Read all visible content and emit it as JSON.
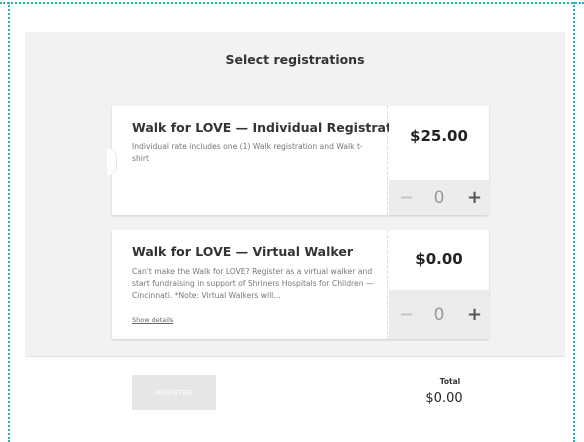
{
  "page": {
    "title": "Select registrations"
  },
  "registrations": [
    {
      "name": "Walk for LOVE — Individual Registration",
      "description": "Individual rate includes one (1) Walk registration and Walk t-shirt",
      "price": "$25.00",
      "quantity": "0",
      "minus": "−",
      "plus": "+"
    },
    {
      "name": "Walk for LOVE — Virtual Walker",
      "description": "Can't make the Walk for LOVE? Register as a virtual walker and start fundraising in support of Shriners Hospitals for Children — Cincinnati. *Note: Virtual Walkers will...",
      "show_details": "Show details",
      "price": "$0.00",
      "quantity": "0",
      "minus": "−",
      "plus": "+"
    }
  ],
  "footer": {
    "register_label": "REGISTER",
    "total_label": "Total",
    "total_value": "$0.00"
  },
  "colors": {
    "frame": "#2bb3b7",
    "panel_bg": "#f2f2f2",
    "qty_bg": "#ececec",
    "button_disabled": "#e6e6e6"
  }
}
